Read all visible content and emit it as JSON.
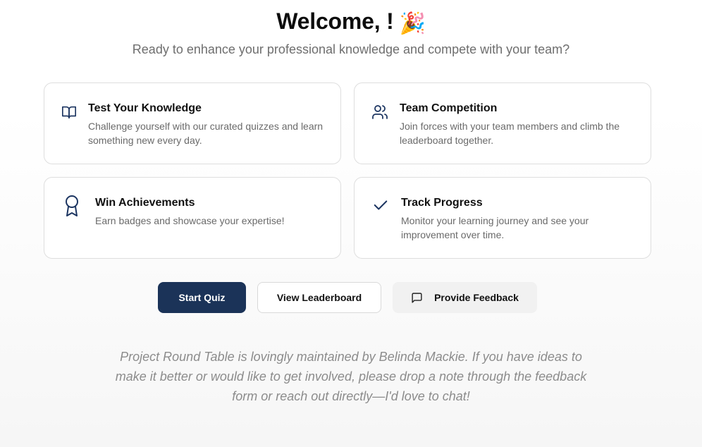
{
  "header": {
    "welcome_text": "Welcome, !",
    "welcome_emoji": "🎉",
    "subtitle": "Ready to enhance your professional knowledge and compete with your team?"
  },
  "features": [
    {
      "icon": "book-open-icon",
      "title": "Test Your Knowledge",
      "description": "Challenge yourself with our curated quizzes and learn something new every day."
    },
    {
      "icon": "users-icon",
      "title": "Team Competition",
      "description": "Join forces with your team members and climb the leaderboard together."
    },
    {
      "icon": "award-icon",
      "title": "Win Achievements",
      "description": "Earn badges and showcase your expertise!"
    },
    {
      "icon": "check-icon",
      "title": "Track Progress",
      "description": "Monitor your learning journey and see your improvement over time."
    }
  ],
  "actions": {
    "start_quiz": "Start Quiz",
    "view_leaderboard": "View Leaderboard",
    "provide_feedback": "Provide Feedback"
  },
  "footer": {
    "note": "Project Round Table is lovingly maintained by Belinda Mackie. If you have ideas to make it better or would like to get involved, please drop a note through the feedback form or reach out directly—I'd love to chat!"
  },
  "colors": {
    "primary": "#1b3358",
    "icon": "#1c3561",
    "muted_text": "#6a6a6a",
    "card_border": "#dedede"
  }
}
